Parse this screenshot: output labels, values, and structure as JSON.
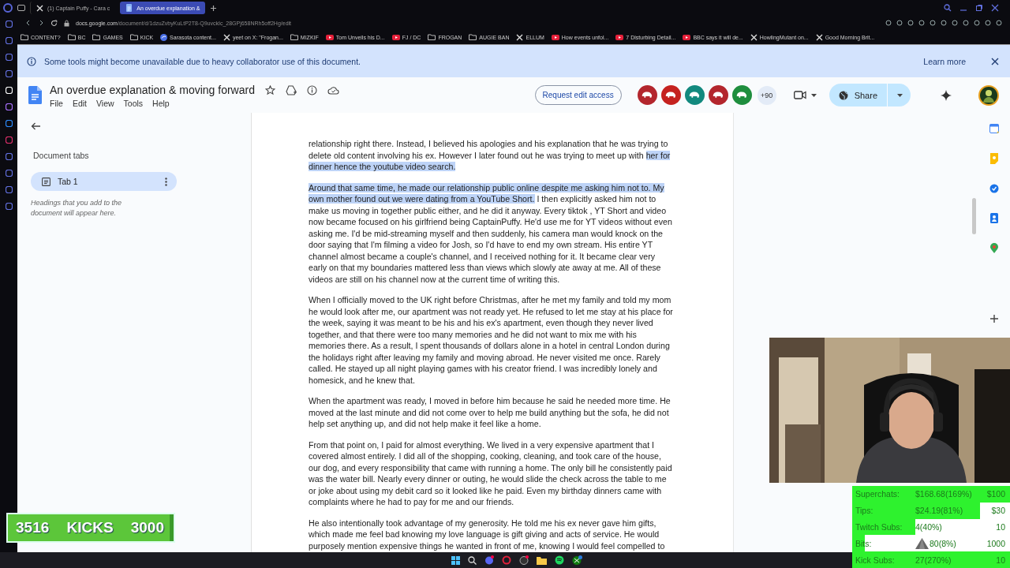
{
  "browser": {
    "tabs": [
      {
        "title": "(1) Captain Puffy - Cara c",
        "kind": "x",
        "selected": false
      },
      {
        "title": "An overdue explanation &",
        "kind": "docs",
        "selected": true
      }
    ],
    "url": {
      "domain": "docs.google.com",
      "path": "/document/d/1dzuZvbyKuLtP2T8-Q9uvckIc_28GPj658NRh5off2Hg/edit"
    },
    "bookmarks": [
      {
        "kind": "folder",
        "label": "CONTENT?"
      },
      {
        "kind": "folder",
        "label": "BC"
      },
      {
        "kind": "folder",
        "label": "GAMES"
      },
      {
        "kind": "folder",
        "label": "KICK"
      },
      {
        "kind": "site",
        "label": "Sarasota content..."
      },
      {
        "kind": "x",
        "label": "yeet on X: \"Frogan..."
      },
      {
        "kind": "folder",
        "label": "MIZKIF"
      },
      {
        "kind": "youtube",
        "label": "Tom Unveils his D..."
      },
      {
        "kind": "youtube",
        "label": "FJ / DC"
      },
      {
        "kind": "folder",
        "label": "FROGAN"
      },
      {
        "kind": "folder",
        "label": "AUGIE BAN"
      },
      {
        "kind": "x",
        "label": "ELLUM"
      },
      {
        "kind": "youtube",
        "label": "How events unfol..."
      },
      {
        "kind": "youtube",
        "label": "7 Disturbing Detail..."
      },
      {
        "kind": "youtube",
        "label": "BBC says it will de..."
      },
      {
        "kind": "x",
        "label": "HowlingMutant on..."
      },
      {
        "kind": "x",
        "label": "Good Morning Brit..."
      }
    ]
  },
  "banner": {
    "message": "Some tools might become unavailable due to heavy collaborator use of this document.",
    "link": "Learn more"
  },
  "document": {
    "title": "An overdue explanation & moving forward",
    "menu": [
      "File",
      "Edit",
      "View",
      "Tools",
      "Help"
    ],
    "request_button": "Request edit access",
    "collaborators": [
      {
        "color": "#b3262d"
      },
      {
        "color": "#c5221f"
      },
      {
        "color": "#12897e"
      },
      {
        "color": "#b3262d"
      },
      {
        "color": "#1e8e3e"
      }
    ],
    "more_collaborators": "+90",
    "share_button": "Share"
  },
  "sidebar": {
    "heading": "Document tabs",
    "tabs": [
      {
        "label": "Tab 1",
        "selected": true
      }
    ],
    "hint": "Headings that you add to the document will appear here."
  },
  "page": {
    "paragraphs": [
      {
        "segments": [
          {
            "text": "relationship right there. Instead, I believed his apologies and his explanation that he was trying to delete old content involving his ex. However I later found out he was trying to meet up with ",
            "highlighted": false
          },
          {
            "text": "her for dinner hence the youtube video search.",
            "highlighted": true
          }
        ]
      },
      {
        "segments": [
          {
            "text": "Around that same time, he made our relationship public online despite me asking him not to. My own mother found out we were dating from a YouTube Short.",
            "highlighted": true
          },
          {
            "text": " I then explicitly asked him not to make us moving in together public either, and he did it anyway. Every tiktok , YT Short and video now became focused on his girlfriend being CaptainPuffy. He'd use me for YT videos without even asking me. I'd be mid-streaming myself and then suddenly, his camera man would knock on the door saying that I'm filming a video for Josh, so I'd have to end my own stream. His entire YT channel almost became a couple's channel, and I received nothing for it. It became clear very early on that my boundaries mattered less than views which slowly ate away at me. All of these videos are still on his channel now at the current time of writing this.",
            "highlighted": false
          }
        ]
      },
      {
        "segments": [
          {
            "text": "When I officially moved to the UK right before Christmas, after he met my family and told my mom he would look after me, our apartment was not ready yet. He refused to let me stay at his place for the week, saying it was meant to be his and his ex's apartment, even though they never lived together, and that there were too many memories and he did not want to mix me with his memories there. As a result, I spent thousands of dollars alone in a hotel in central London during the holidays right after leaving my family and moving abroad. He never visited me once. Rarely called. He stayed up all night playing games with his creator friend. I was incredibly lonely and homesick, and he knew that.",
            "highlighted": false
          }
        ]
      },
      {
        "segments": [
          {
            "text": "When the apartment was ready, I moved in before him because he said he needed more time. He moved at the last minute and did not come over to help me build anything but the sofa, he did not help set anything up, and did not help make it feel like a home.",
            "highlighted": false
          }
        ]
      },
      {
        "segments": [
          {
            "text": "From that point on, I paid for almost everything. We lived in a very expensive apartment that I covered almost entirely. I did all of the shopping, cooking, cleaning, and took care of the house, our dog, and every responsibility that came with running a home. The only bill he consistently paid was the water bill. Nearly every dinner or outing, he would slide the check across the table to me or joke about using my debit card so it looked like he paid. Even my birthday dinners came with complaints where he had to pay for me and our friends.",
            "highlighted": false
          }
        ]
      },
      {
        "segments": [
          {
            "text": "He also intentionally took advantage of my generosity. He told me his ex never gave him gifts, which made me feel bad knowing my love language is gift giving and acts of service. He would purposely mention expensive things he wanted in front of me, knowing I would feel compelled to",
            "highlighted": false
          }
        ]
      }
    ]
  },
  "stream_overlay": {
    "goals": [
      {
        "label": "Superchats:",
        "value": "$168.68(169%)",
        "target": "$100",
        "level": 1
      },
      {
        "label": "Tips:",
        "value": "$24.19(81%)",
        "target": "$30",
        "level": 0.81
      },
      {
        "label": "Twitch Subs:",
        "value": "4(40%)",
        "target": "10",
        "level": 0.4
      },
      {
        "label": "Bits:",
        "value": "80(8%)",
        "target": "1000",
        "level": 0.08,
        "kind": "bits"
      },
      {
        "label": "Kick Subs:",
        "value": "27(270%)",
        "target": "10",
        "level": 1
      }
    ],
    "kicks": {
      "count": "3516",
      "label": "KICKS",
      "goal": "3000"
    }
  }
}
